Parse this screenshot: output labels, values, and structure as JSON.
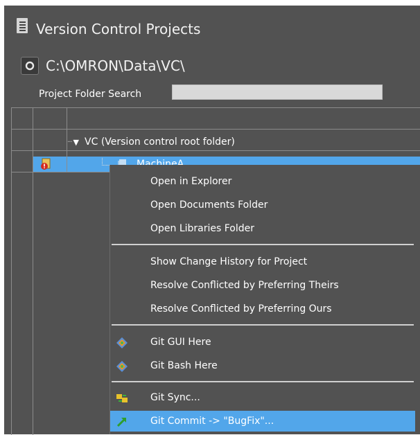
{
  "header": {
    "title": "Version Control Projects"
  },
  "path": {
    "value": "C:\\OMRON\\Data\\VC\\"
  },
  "search": {
    "label": "Project Folder Search",
    "value": ""
  },
  "tree": {
    "root_label": "VC (Version control root folder)",
    "child_label": "MachineA"
  },
  "context_menu": {
    "items": [
      {
        "label": "Open in Explorer"
      },
      {
        "label": "Open Documents Folder"
      },
      {
        "label": "Open Libraries Folder"
      },
      {
        "label": "Show Change History for Project"
      },
      {
        "label": "Resolve Conflicted by Preferring Theirs"
      },
      {
        "label": "Resolve Conflicted by Preferring Ours"
      },
      {
        "label": "Git GUI Here",
        "icon": "git-diamond-icon"
      },
      {
        "label": "Git Bash Here",
        "icon": "git-diamond-icon"
      },
      {
        "label": "Git Sync...",
        "icon": "git-sync-icon"
      },
      {
        "label": "Git Commit -> \"BugFix\"...",
        "icon": "git-commit-arrow-icon",
        "highlighted": true
      }
    ]
  },
  "colors": {
    "panel_bg": "#525252",
    "selection": "#52a6ea"
  }
}
